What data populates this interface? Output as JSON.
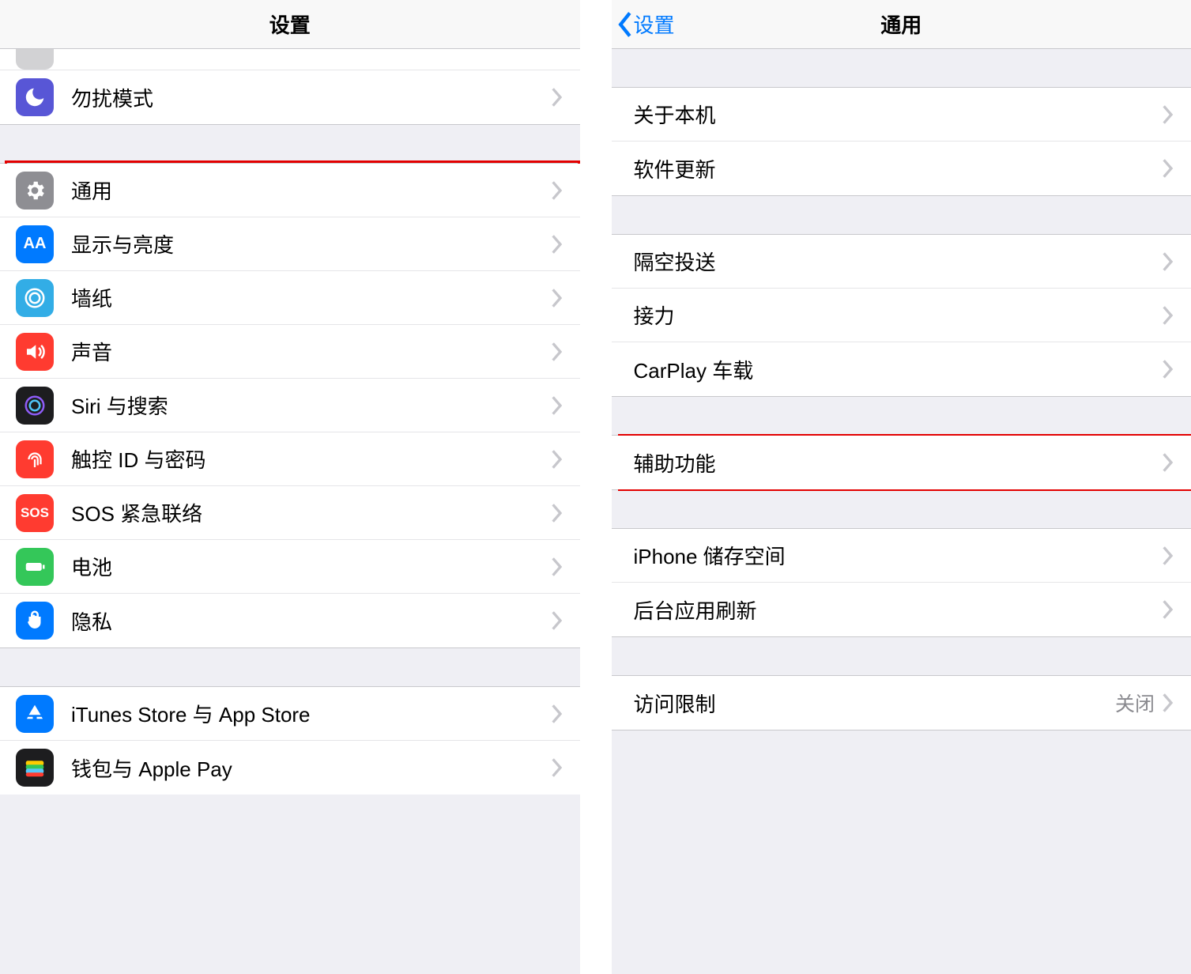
{
  "left": {
    "title": "设置",
    "groups": [
      {
        "rows": [
          {
            "icon": "moon-icon",
            "iconClass": "ic-purple",
            "label": "勿扰模式"
          }
        ]
      },
      {
        "rows": [
          {
            "icon": "gear-icon",
            "iconClass": "ic-gray",
            "label": "通用",
            "highlight": true
          },
          {
            "icon": "textsize-icon",
            "iconClass": "ic-blue",
            "label": "显示与亮度"
          },
          {
            "icon": "wallpaper-icon",
            "iconClass": "ic-cyan",
            "label": "墙纸"
          },
          {
            "icon": "sound-icon",
            "iconClass": "ic-red",
            "label": "声音"
          },
          {
            "icon": "siri-icon",
            "iconClass": "ic-black",
            "label": "Siri 与搜索"
          },
          {
            "icon": "fingerprint-icon",
            "iconClass": "ic-red",
            "label": "触控 ID 与密码"
          },
          {
            "icon": "sos-icon",
            "iconClass": "ic-red",
            "label": "SOS 紧急联络"
          },
          {
            "icon": "battery-icon",
            "iconClass": "ic-green",
            "label": "电池"
          },
          {
            "icon": "privacy-icon",
            "iconClass": "ic-blue",
            "label": "隐私"
          }
        ]
      },
      {
        "rows": [
          {
            "icon": "appstore-icon",
            "iconClass": "ic-blue",
            "label": "iTunes Store 与 App Store"
          },
          {
            "icon": "wallet-icon",
            "iconClass": "ic-white",
            "label": "钱包与 Apple Pay"
          }
        ]
      }
    ]
  },
  "right": {
    "back": "设置",
    "title": "通用",
    "groups": [
      {
        "rows": [
          {
            "label": "关于本机"
          },
          {
            "label": "软件更新"
          }
        ]
      },
      {
        "rows": [
          {
            "label": "隔空投送"
          },
          {
            "label": "接力"
          },
          {
            "label": "CarPlay 车载"
          }
        ]
      },
      {
        "rows": [
          {
            "label": "辅助功能",
            "highlight": true
          }
        ]
      },
      {
        "rows": [
          {
            "label": "iPhone 储存空间"
          },
          {
            "label": "后台应用刷新"
          }
        ]
      },
      {
        "rows": [
          {
            "label": "访问限制",
            "detail": "关闭"
          }
        ]
      }
    ]
  },
  "colors": {
    "accent": "#007aff",
    "highlight": "#e30000",
    "separator": "#c8c8cc",
    "groupBg": "#efeff4"
  }
}
